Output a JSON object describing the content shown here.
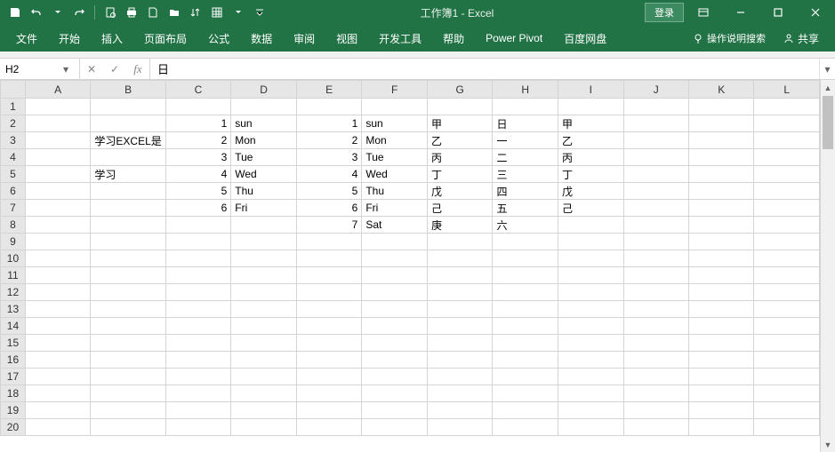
{
  "title": "工作簿1 - Excel",
  "login_label": "登录",
  "ribbon": {
    "tabs": [
      "文件",
      "开始",
      "插入",
      "页面布局",
      "公式",
      "数据",
      "审阅",
      "视图",
      "开发工具",
      "帮助",
      "Power Pivot",
      "百度网盘"
    ],
    "tell_me": "操作说明搜索",
    "share": "共享"
  },
  "namebox": "H2",
  "formula": "日",
  "columns": [
    "A",
    "B",
    "C",
    "D",
    "E",
    "F",
    "G",
    "H",
    "I",
    "J",
    "K",
    "L"
  ],
  "rows": 20,
  "cells": {
    "B3": "学习EXCEL是",
    "B5": "学习",
    "C2": "1",
    "C3": "2",
    "C4": "3",
    "C5": "4",
    "C6": "5",
    "C7": "6",
    "D2": "sun",
    "D3": "Mon",
    "D4": "Tue",
    "D5": "Wed",
    "D6": "Thu",
    "D7": "Fri",
    "E2": "1",
    "E3": "2",
    "E4": "3",
    "E5": "4",
    "E6": "5",
    "E7": "6",
    "E8": "7",
    "F2": "sun",
    "F3": "Mon",
    "F4": "Tue",
    "F5": "Wed",
    "F6": "Thu",
    "F7": "Fri",
    "F8": "Sat",
    "G2": "甲",
    "G3": "乙",
    "G4": "丙",
    "G5": "丁",
    "G6": "戊",
    "G7": "己",
    "G8": "庚",
    "H2": "日",
    "H3": "一",
    "H4": "二",
    "H5": "三",
    "H6": "四",
    "H7": "五",
    "H8": "六",
    "I2": "甲",
    "I3": "乙",
    "I4": "丙",
    "I5": "丁",
    "I6": "戊",
    "I7": "己"
  },
  "numeric_cols": [
    "C",
    "E"
  ]
}
